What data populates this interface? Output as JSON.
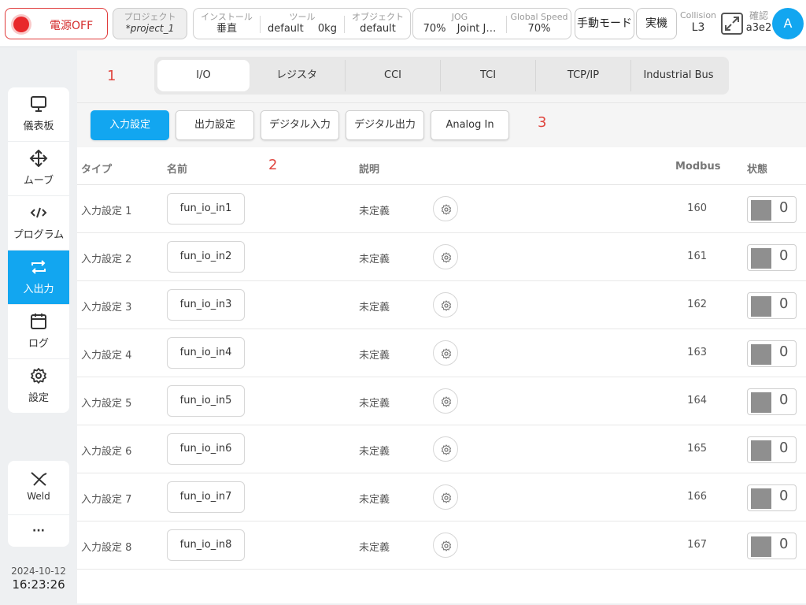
{
  "topbar": {
    "power_label": "電源OFF",
    "project": {
      "label": "プロジェクト",
      "value": "*project_1"
    },
    "install": {
      "label": "インストール",
      "value": "垂直",
      "tool_label": "ツール",
      "tool_value": "default",
      "tool_weight": "0kg",
      "object_label": "オブジェクト",
      "object_value": "default"
    },
    "jog": {
      "label": "JOG",
      "value": "70%",
      "mode": "Joint J…",
      "speed_label": "Global Speed",
      "speed_value": "70%"
    },
    "manual_mode": "手動モード",
    "real_machine": "実機",
    "collision": {
      "label": "Collision",
      "value": "L3"
    },
    "confirm": {
      "label": "確認",
      "value": "a3e2"
    },
    "avatar": "A"
  },
  "sidebar": {
    "items": [
      {
        "label": "儀表板",
        "icon": "monitor-icon"
      },
      {
        "label": "ムーブ",
        "icon": "move-icon"
      },
      {
        "label": "プログラム",
        "icon": "code-icon"
      },
      {
        "label": "入出力",
        "icon": "swap-icon",
        "active": true
      },
      {
        "label": "ログ",
        "icon": "calendar-icon"
      },
      {
        "label": "設定",
        "icon": "gear-icon"
      }
    ],
    "extra": {
      "weld_label": "Weld",
      "more_label": "···"
    },
    "date": "2024-10-12",
    "time": "16:23:26"
  },
  "tabs": [
    "I/O",
    "レジスタ",
    "CCI",
    "TCI",
    "TCP/IP",
    "Industrial Bus"
  ],
  "active_tab": "I/O",
  "subtabs": [
    "入力設定",
    "出力設定",
    "デジタル入力",
    "デジタル出力",
    "Analog In"
  ],
  "active_subtab": "入力設定",
  "annotations": [
    "1",
    "2",
    "3"
  ],
  "table": {
    "headers": {
      "type": "タイプ",
      "name": "名前",
      "desc": "説明",
      "modbus": "Modbus",
      "state": "状態"
    },
    "rows": [
      {
        "type": "入力設定 1",
        "name": "fun_io_in1",
        "desc": "未定義",
        "modbus": "160",
        "state": "0"
      },
      {
        "type": "入力設定 2",
        "name": "fun_io_in2",
        "desc": "未定義",
        "modbus": "161",
        "state": "0"
      },
      {
        "type": "入力設定 3",
        "name": "fun_io_in3",
        "desc": "未定義",
        "modbus": "162",
        "state": "0"
      },
      {
        "type": "入力設定 4",
        "name": "fun_io_in4",
        "desc": "未定義",
        "modbus": "163",
        "state": "0"
      },
      {
        "type": "入力設定 5",
        "name": "fun_io_in5",
        "desc": "未定義",
        "modbus": "164",
        "state": "0"
      },
      {
        "type": "入力設定 6",
        "name": "fun_io_in6",
        "desc": "未定義",
        "modbus": "165",
        "state": "0"
      },
      {
        "type": "入力設定 7",
        "name": "fun_io_in7",
        "desc": "未定義",
        "modbus": "166",
        "state": "0"
      },
      {
        "type": "入力設定 8",
        "name": "fun_io_in8",
        "desc": "未定義",
        "modbus": "167",
        "state": "0"
      }
    ]
  },
  "colors": {
    "accent": "#12a6f0",
    "power": "#e8282b",
    "annotation": "#e0463f"
  }
}
